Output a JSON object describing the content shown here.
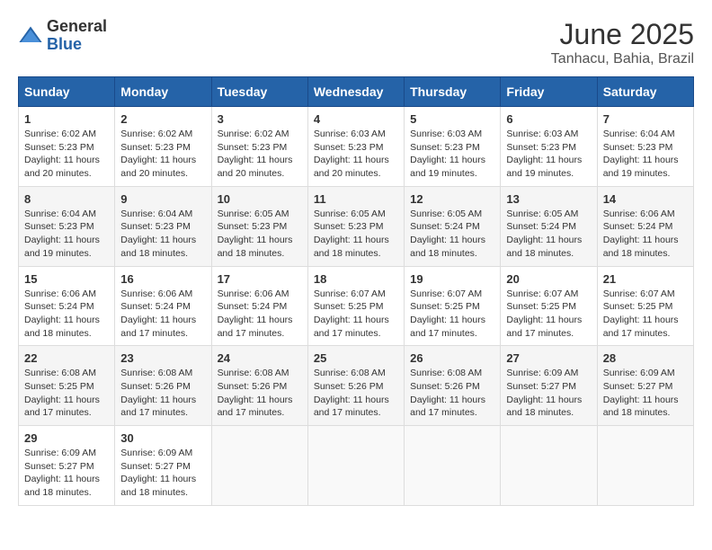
{
  "logo": {
    "general": "General",
    "blue": "Blue"
  },
  "title": "June 2025",
  "subtitle": "Tanhacu, Bahia, Brazil",
  "days_of_week": [
    "Sunday",
    "Monday",
    "Tuesday",
    "Wednesday",
    "Thursday",
    "Friday",
    "Saturday"
  ],
  "weeks": [
    [
      {
        "day": "1",
        "sunrise": "6:02 AM",
        "sunset": "5:23 PM",
        "daylight": "11 hours and 20 minutes."
      },
      {
        "day": "2",
        "sunrise": "6:02 AM",
        "sunset": "5:23 PM",
        "daylight": "11 hours and 20 minutes."
      },
      {
        "day": "3",
        "sunrise": "6:02 AM",
        "sunset": "5:23 PM",
        "daylight": "11 hours and 20 minutes."
      },
      {
        "day": "4",
        "sunrise": "6:03 AM",
        "sunset": "5:23 PM",
        "daylight": "11 hours and 20 minutes."
      },
      {
        "day": "5",
        "sunrise": "6:03 AM",
        "sunset": "5:23 PM",
        "daylight": "11 hours and 19 minutes."
      },
      {
        "day": "6",
        "sunrise": "6:03 AM",
        "sunset": "5:23 PM",
        "daylight": "11 hours and 19 minutes."
      },
      {
        "day": "7",
        "sunrise": "6:04 AM",
        "sunset": "5:23 PM",
        "daylight": "11 hours and 19 minutes."
      }
    ],
    [
      {
        "day": "8",
        "sunrise": "6:04 AM",
        "sunset": "5:23 PM",
        "daylight": "11 hours and 19 minutes."
      },
      {
        "day": "9",
        "sunrise": "6:04 AM",
        "sunset": "5:23 PM",
        "daylight": "11 hours and 18 minutes."
      },
      {
        "day": "10",
        "sunrise": "6:05 AM",
        "sunset": "5:23 PM",
        "daylight": "11 hours and 18 minutes."
      },
      {
        "day": "11",
        "sunrise": "6:05 AM",
        "sunset": "5:23 PM",
        "daylight": "11 hours and 18 minutes."
      },
      {
        "day": "12",
        "sunrise": "6:05 AM",
        "sunset": "5:24 PM",
        "daylight": "11 hours and 18 minutes."
      },
      {
        "day": "13",
        "sunrise": "6:05 AM",
        "sunset": "5:24 PM",
        "daylight": "11 hours and 18 minutes."
      },
      {
        "day": "14",
        "sunrise": "6:06 AM",
        "sunset": "5:24 PM",
        "daylight": "11 hours and 18 minutes."
      }
    ],
    [
      {
        "day": "15",
        "sunrise": "6:06 AM",
        "sunset": "5:24 PM",
        "daylight": "11 hours and 18 minutes."
      },
      {
        "day": "16",
        "sunrise": "6:06 AM",
        "sunset": "5:24 PM",
        "daylight": "11 hours and 17 minutes."
      },
      {
        "day": "17",
        "sunrise": "6:06 AM",
        "sunset": "5:24 PM",
        "daylight": "11 hours and 17 minutes."
      },
      {
        "day": "18",
        "sunrise": "6:07 AM",
        "sunset": "5:25 PM",
        "daylight": "11 hours and 17 minutes."
      },
      {
        "day": "19",
        "sunrise": "6:07 AM",
        "sunset": "5:25 PM",
        "daylight": "11 hours and 17 minutes."
      },
      {
        "day": "20",
        "sunrise": "6:07 AM",
        "sunset": "5:25 PM",
        "daylight": "11 hours and 17 minutes."
      },
      {
        "day": "21",
        "sunrise": "6:07 AM",
        "sunset": "5:25 PM",
        "daylight": "11 hours and 17 minutes."
      }
    ],
    [
      {
        "day": "22",
        "sunrise": "6:08 AM",
        "sunset": "5:25 PM",
        "daylight": "11 hours and 17 minutes."
      },
      {
        "day": "23",
        "sunrise": "6:08 AM",
        "sunset": "5:26 PM",
        "daylight": "11 hours and 17 minutes."
      },
      {
        "day": "24",
        "sunrise": "6:08 AM",
        "sunset": "5:26 PM",
        "daylight": "11 hours and 17 minutes."
      },
      {
        "day": "25",
        "sunrise": "6:08 AM",
        "sunset": "5:26 PM",
        "daylight": "11 hours and 17 minutes."
      },
      {
        "day": "26",
        "sunrise": "6:08 AM",
        "sunset": "5:26 PM",
        "daylight": "11 hours and 17 minutes."
      },
      {
        "day": "27",
        "sunrise": "6:09 AM",
        "sunset": "5:27 PM",
        "daylight": "11 hours and 18 minutes."
      },
      {
        "day": "28",
        "sunrise": "6:09 AM",
        "sunset": "5:27 PM",
        "daylight": "11 hours and 18 minutes."
      }
    ],
    [
      {
        "day": "29",
        "sunrise": "6:09 AM",
        "sunset": "5:27 PM",
        "daylight": "11 hours and 18 minutes."
      },
      {
        "day": "30",
        "sunrise": "6:09 AM",
        "sunset": "5:27 PM",
        "daylight": "11 hours and 18 minutes."
      },
      null,
      null,
      null,
      null,
      null
    ]
  ]
}
